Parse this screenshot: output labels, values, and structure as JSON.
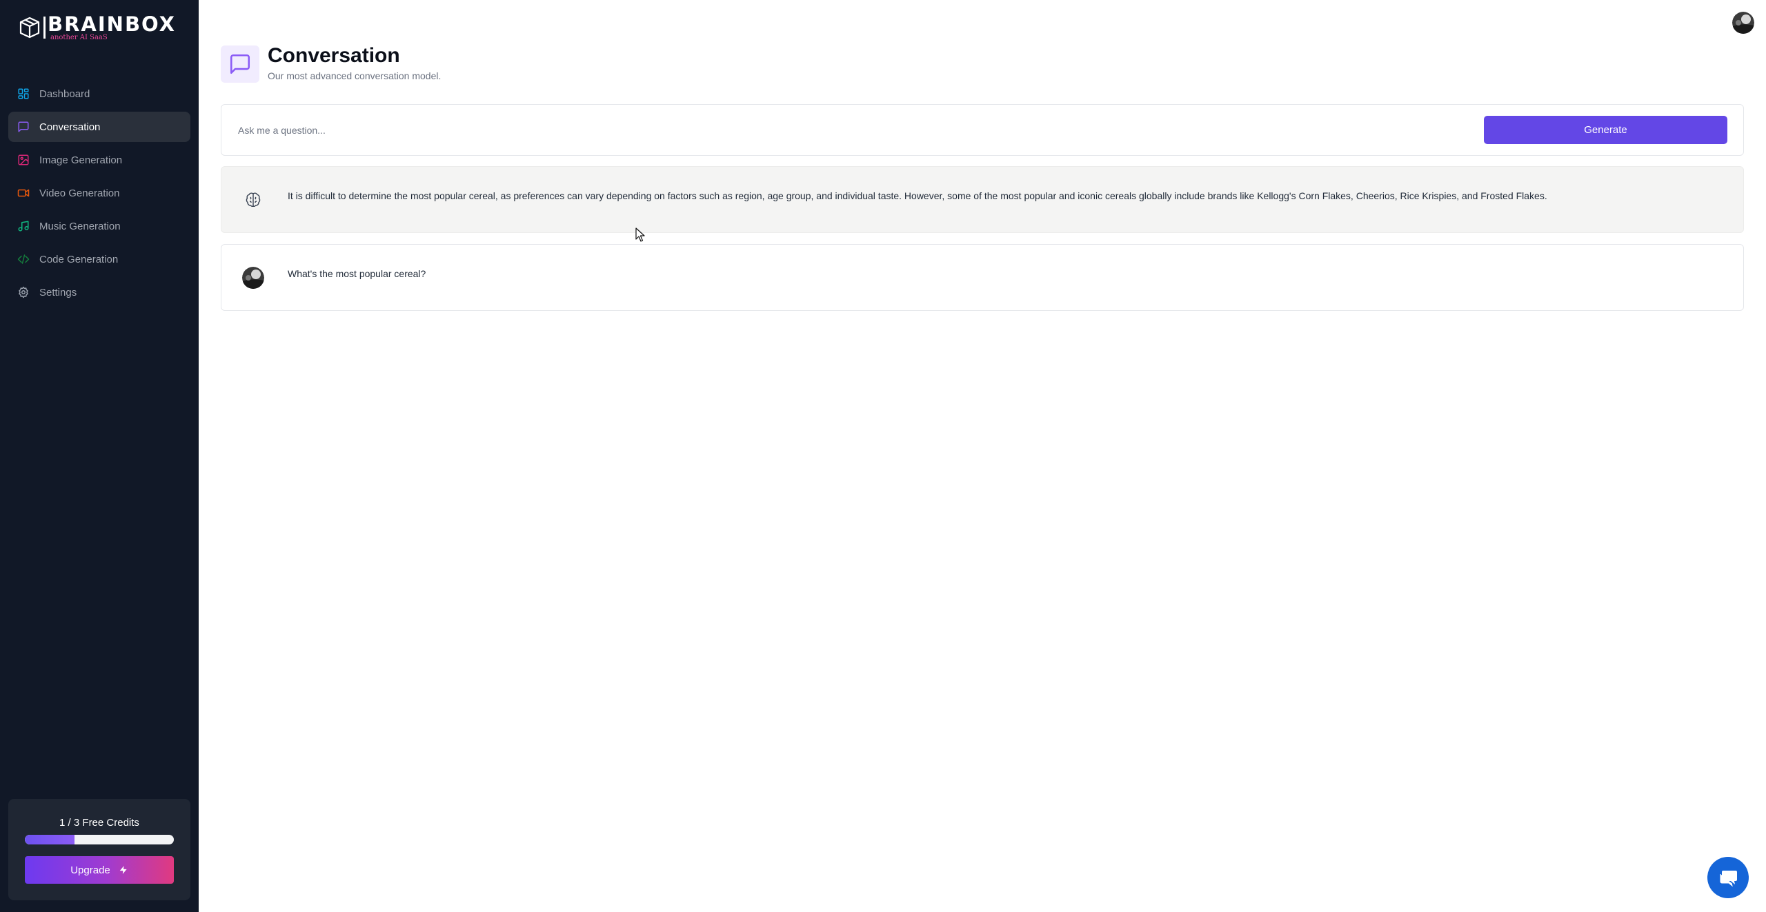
{
  "brand": {
    "name": "BRAINBOX",
    "tagline": "another AI SaaS"
  },
  "sidebar": {
    "items": [
      {
        "label": "Dashboard",
        "icon": "layout-dashboard-icon",
        "color": "#0ea5e9"
      },
      {
        "label": "Conversation",
        "icon": "message-square-icon",
        "color": "#8b5cf6",
        "active": true
      },
      {
        "label": "Image Generation",
        "icon": "image-icon",
        "color": "#db2777"
      },
      {
        "label": "Video Generation",
        "icon": "video-icon",
        "color": "#ea580c"
      },
      {
        "label": "Music Generation",
        "icon": "music-icon",
        "color": "#10b981"
      },
      {
        "label": "Code Generation",
        "icon": "code-icon",
        "color": "#15803d"
      },
      {
        "label": "Settings",
        "icon": "settings-icon",
        "color": "#9ca3af"
      }
    ]
  },
  "credits": {
    "text": "1 / 3 Free Credits",
    "used": 1,
    "total": 3
  },
  "upgrade": {
    "label": "Upgrade"
  },
  "header": {
    "title": "Conversation",
    "subtitle": "Our most advanced conversation model."
  },
  "prompt": {
    "placeholder": "Ask me a question...",
    "value": ""
  },
  "generate": {
    "label": "Generate"
  },
  "messages": [
    {
      "role": "bot",
      "icon": "brain-icon",
      "text": "It is difficult to determine the most popular cereal, as preferences can vary depending on factors such as region, age group, and individual taste. However, some of the most popular and iconic cereals globally include brands like Kellogg's Corn Flakes, Cheerios, Rice Krispies, and Frosted Flakes."
    },
    {
      "role": "user",
      "icon": "user-avatar",
      "text": "What's the most popular cereal?"
    }
  ],
  "colors": {
    "accent": "#6347e6",
    "sidebar_bg": "#111827",
    "chat_bubble": "#1565d8"
  }
}
